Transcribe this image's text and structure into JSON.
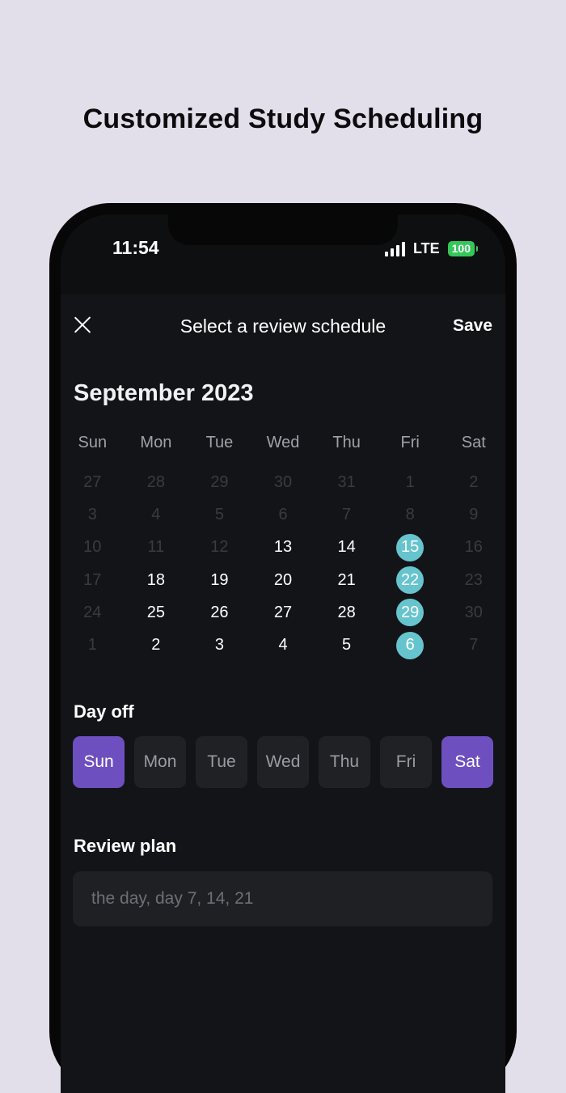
{
  "headline": "Customized Study Scheduling",
  "status": {
    "time": "11:54",
    "network": "LTE",
    "battery": "100"
  },
  "nav": {
    "title": "Select a review schedule",
    "save_label": "Save"
  },
  "calendar": {
    "month_title": "September 2023",
    "weekdays": [
      "Sun",
      "Mon",
      "Tue",
      "Wed",
      "Thu",
      "Fri",
      "Sat"
    ],
    "weeks": [
      [
        {
          "d": "27",
          "s": "muted"
        },
        {
          "d": "28",
          "s": "muted"
        },
        {
          "d": "29",
          "s": "muted"
        },
        {
          "d": "30",
          "s": "muted"
        },
        {
          "d": "31",
          "s": "muted"
        },
        {
          "d": "1",
          "s": "muted"
        },
        {
          "d": "2",
          "s": "muted"
        }
      ],
      [
        {
          "d": "3",
          "s": "muted"
        },
        {
          "d": "4",
          "s": "muted"
        },
        {
          "d": "5",
          "s": "muted"
        },
        {
          "d": "6",
          "s": "muted"
        },
        {
          "d": "7",
          "s": "muted"
        },
        {
          "d": "8",
          "s": "muted"
        },
        {
          "d": "9",
          "s": "muted"
        }
      ],
      [
        {
          "d": "10",
          "s": "muted"
        },
        {
          "d": "11",
          "s": "muted"
        },
        {
          "d": "12",
          "s": "muted"
        },
        {
          "d": "13",
          "s": "active"
        },
        {
          "d": "14",
          "s": "active"
        },
        {
          "d": "15",
          "s": "sel"
        },
        {
          "d": "16",
          "s": "muted"
        }
      ],
      [
        {
          "d": "17",
          "s": "muted"
        },
        {
          "d": "18",
          "s": "active"
        },
        {
          "d": "19",
          "s": "active"
        },
        {
          "d": "20",
          "s": "active"
        },
        {
          "d": "21",
          "s": "active"
        },
        {
          "d": "22",
          "s": "sel"
        },
        {
          "d": "23",
          "s": "muted"
        }
      ],
      [
        {
          "d": "24",
          "s": "muted"
        },
        {
          "d": "25",
          "s": "active"
        },
        {
          "d": "26",
          "s": "active"
        },
        {
          "d": "27",
          "s": "active"
        },
        {
          "d": "28",
          "s": "active"
        },
        {
          "d": "29",
          "s": "sel"
        },
        {
          "d": "30",
          "s": "muted"
        }
      ],
      [
        {
          "d": "1",
          "s": "muted"
        },
        {
          "d": "2",
          "s": "active"
        },
        {
          "d": "3",
          "s": "active"
        },
        {
          "d": "4",
          "s": "active"
        },
        {
          "d": "5",
          "s": "active"
        },
        {
          "d": "6",
          "s": "sel"
        },
        {
          "d": "7",
          "s": "muted"
        }
      ]
    ]
  },
  "day_off": {
    "label": "Day off",
    "days": [
      {
        "label": "Sun",
        "on": true
      },
      {
        "label": "Mon",
        "on": false
      },
      {
        "label": "Tue",
        "on": false
      },
      {
        "label": "Wed",
        "on": false
      },
      {
        "label": "Thu",
        "on": false
      },
      {
        "label": "Fri",
        "on": false
      },
      {
        "label": "Sat",
        "on": true
      }
    ]
  },
  "review_plan": {
    "label": "Review plan",
    "placeholder": "the day, day 7, 14, 21"
  },
  "colors": {
    "accent_purple": "#6e4fbf",
    "selected_teal": "#66c4cf",
    "background": "#e3dfea"
  }
}
